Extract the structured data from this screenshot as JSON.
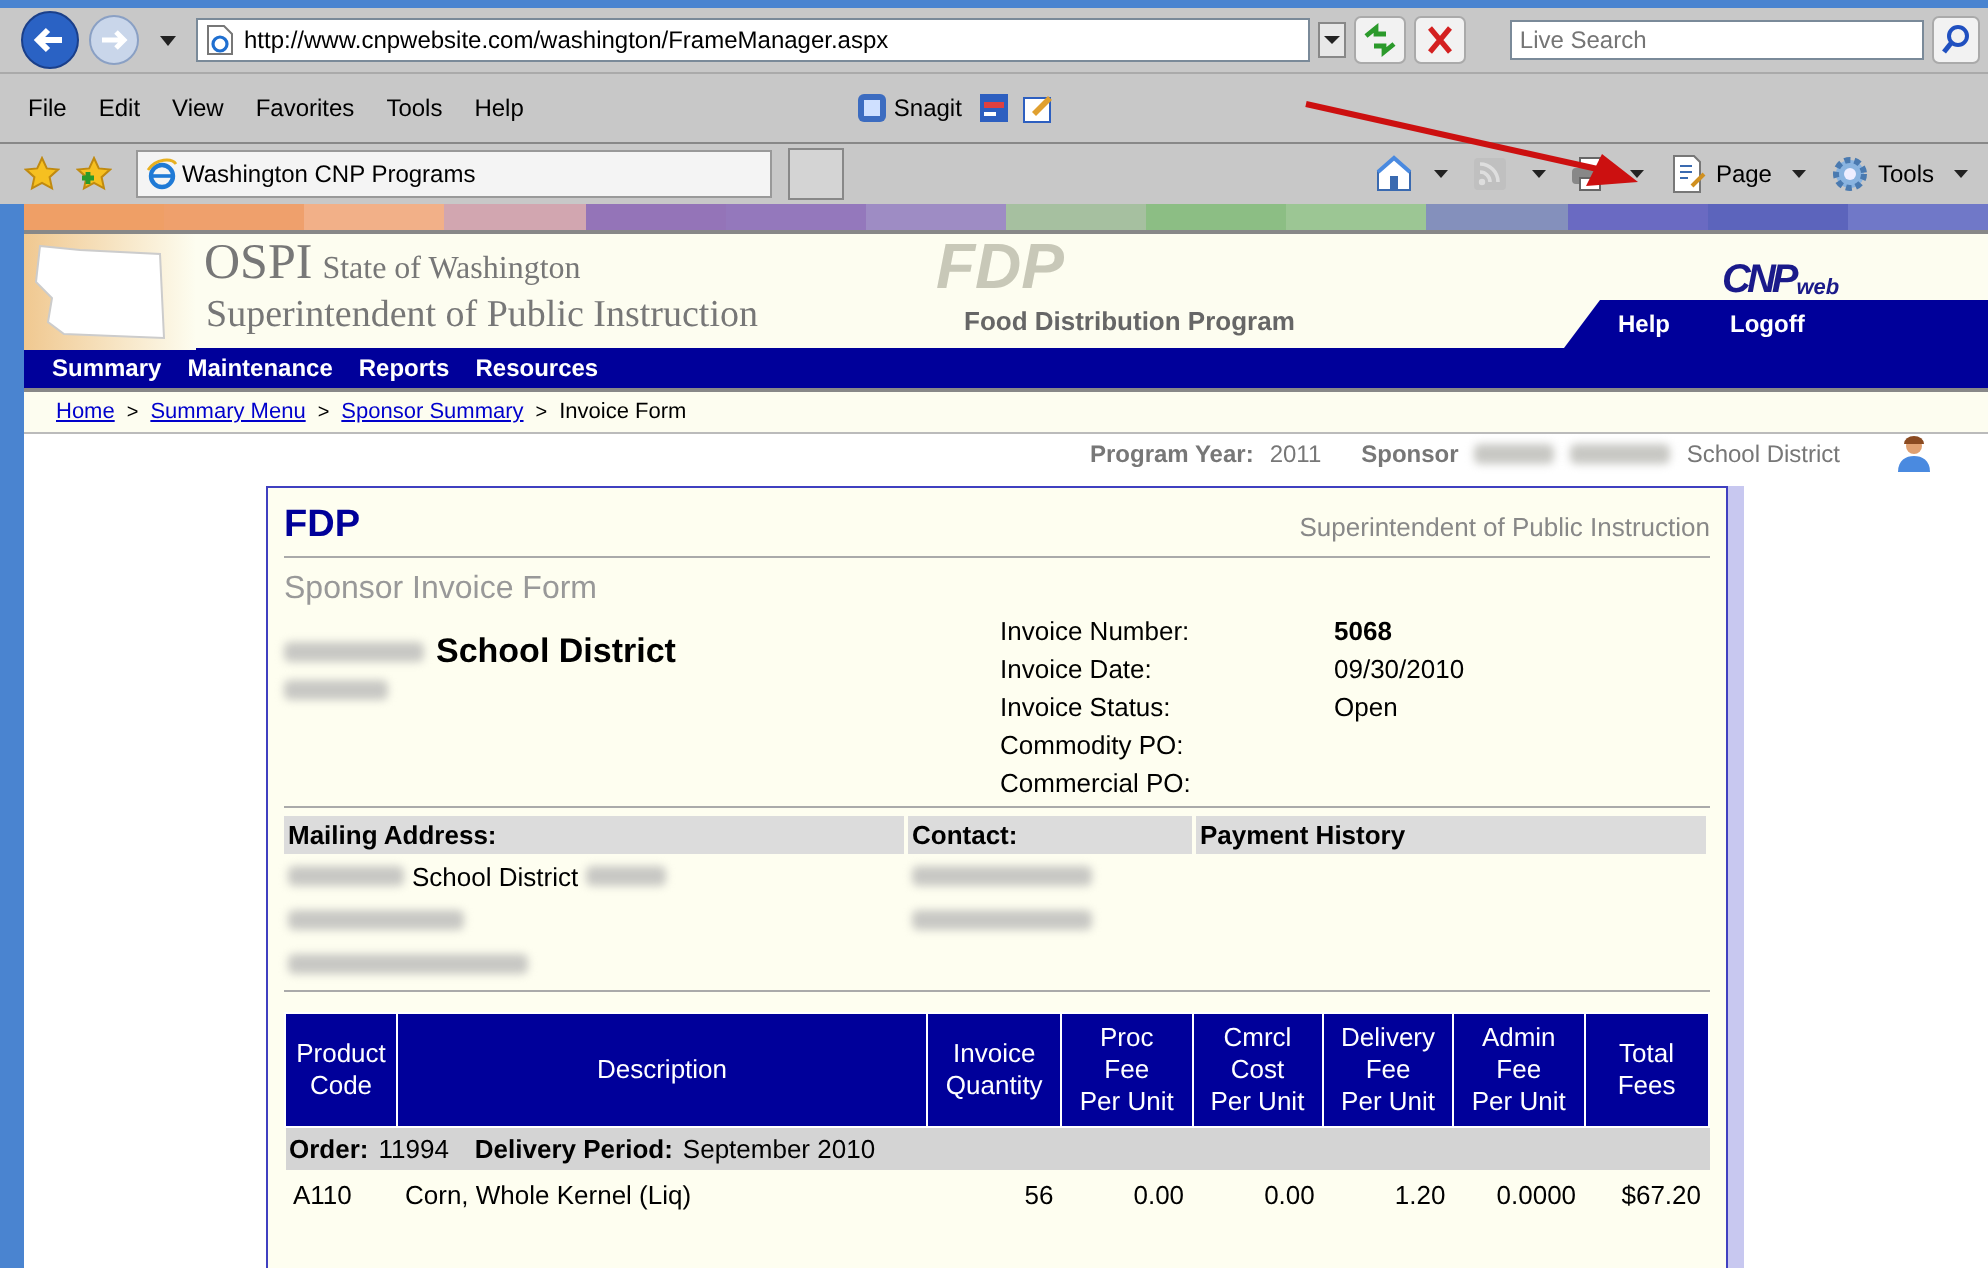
{
  "browser": {
    "address": "http://www.cnpwebsite.com/washington/FrameManager.aspx",
    "search_placeholder": "Live Search",
    "menu": [
      "File",
      "Edit",
      "View",
      "Favorites",
      "Tools",
      "Help"
    ],
    "snagit": "Snagit",
    "tab_title": "Washington CNP Programs",
    "command_bar": [
      {
        "kind": "home",
        "disabled": false
      },
      {
        "kind": "feed",
        "disabled": true
      },
      {
        "kind": "print",
        "disabled": false
      },
      {
        "kind": "page",
        "label": "Page",
        "disabled": false
      },
      {
        "kind": "tools",
        "label": "Tools",
        "disabled": false
      }
    ]
  },
  "header": {
    "org": "OSPI",
    "state": "State of Washington",
    "agency": "Superintendent of Public Instruction",
    "watermark": "FDP",
    "program": "Food Distribution Program",
    "logo": "CNP",
    "logo_sub": "web",
    "links": [
      "Help",
      "Logoff"
    ]
  },
  "nav": [
    "Summary",
    "Maintenance",
    "Reports",
    "Resources"
  ],
  "breadcrumb": [
    {
      "label": "Home",
      "link": true
    },
    {
      "separator": ">",
      "label": "Summary Menu",
      "link": true
    },
    {
      "separator": ">",
      "label": "Sponsor Summary",
      "link": true
    },
    {
      "separator": ">",
      "label": "Invoice Form",
      "link": false
    }
  ],
  "context": {
    "year_label": "Program Year:",
    "year": "2011",
    "sponsor_label": "Sponsor",
    "sponsor": "School District"
  },
  "form": {
    "brand": "FDP",
    "agency": "Superintendent of Public Instruction",
    "title": "Sponsor Invoice Form",
    "district": "School District",
    "fields": [
      {
        "label": "Invoice Number:",
        "value": "5068",
        "bold": true
      },
      {
        "label": "Invoice Date:",
        "value": "09/30/2010",
        "bold": false
      },
      {
        "label": "Invoice Status:",
        "value": "Open",
        "bold": false
      },
      {
        "label": "Commodity PO:"
      },
      {
        "label": "Commercial PO:"
      }
    ],
    "sections": [
      {
        "heading": "Mailing Address:",
        "lines": [
          [
            {
              "kind": "blur"
            },
            {
              "kind": "text",
              "text": "School District"
            },
            {
              "kind": "blur"
            }
          ],
          [
            {
              "kind": "blur"
            }
          ],
          [
            {
              "kind": "blur"
            }
          ]
        ]
      },
      {
        "heading": "Contact:",
        "lines": [
          [
            {
              "kind": "blur"
            }
          ],
          [
            {
              "kind": "blur"
            }
          ]
        ]
      },
      {
        "heading": "Payment History"
      }
    ]
  },
  "table": {
    "columns": [
      "Product\nCode",
      "Description",
      "Invoice\nQuantity",
      "Proc\nFee\nPer Unit",
      "Cmrcl\nCost\nPer Unit",
      "Delivery\nFee\nPer Unit",
      "Admin\nFee\nPer Unit",
      "Total\nFees"
    ],
    "groups": [
      {
        "order_label": "Order:",
        "order": "11994",
        "period_label": "Delivery Period:",
        "period": "September 2010",
        "rows": [
          [
            "A110",
            "Corn, Whole Kernel (Liq)",
            "56",
            "0.00",
            "0.00",
            "1.20",
            "0.0000",
            "$67.20"
          ]
        ]
      }
    ]
  }
}
